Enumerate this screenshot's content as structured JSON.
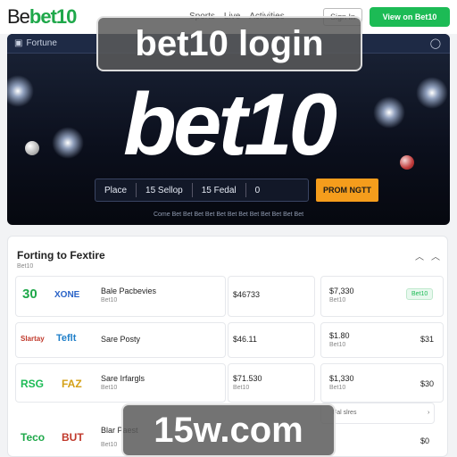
{
  "brand": {
    "prefix": "Be",
    "name": "bet10"
  },
  "topnav": {
    "items": [
      "Sports",
      "Live",
      "Activities"
    ]
  },
  "header": {
    "signin": "Sign In",
    "cta": "View on Bet10"
  },
  "hero": {
    "bar_label": "Fortune",
    "bar_right": "◯",
    "title": "bet10",
    "search": {
      "segments": [
        {
          "label": "Place"
        },
        {
          "label": "15 Sellop"
        },
        {
          "label": "15 Fedal"
        },
        {
          "label": "0"
        }
      ]
    },
    "promo_button": "PROM NGTT",
    "subtitle": "Come Bet Bet Bet Bet Bet Bet Bet Bet Bet Bet Bet Bet"
  },
  "section": {
    "title": "Forting to Fextire",
    "subtitle": "Bet10",
    "rows": [
      {
        "team_a": "30",
        "team_b": "XONE",
        "name": "Bale Pacbevies",
        "sub": "Bet10",
        "odd1": "$46733",
        "odd2": "$7,330",
        "odd2sub": "Bet10",
        "badge": "Bet10",
        "colors": {
          "a": "#1fa84a",
          "b": "#2a63c7"
        }
      },
      {
        "team_a": "Slartay",
        "team_b": "Teflt",
        "name": "Sare Posty",
        "sub": "",
        "odd1": "$46.11",
        "odd2": "$1.80",
        "odd2sub": "Bet10",
        "side": "$31",
        "colors": {
          "a": "#c0392b",
          "b": "#1f7fc9"
        }
      },
      {
        "team_a": "RSG",
        "team_b": "FAZ",
        "name": "Sare Irfargls",
        "sub": "Bet10",
        "odd1": "$71.530",
        "odd1sub": "Bet10",
        "odd2": "$1,330",
        "odd2sub": "Bet10",
        "side": "$30",
        "colors": {
          "a": "#1cbb55",
          "b": "#d4a017"
        }
      },
      {
        "team_a": "Teco",
        "team_b": "BUT",
        "name": "Blar Paest",
        "sub": "Bet10",
        "odd1": "",
        "odd2": "",
        "side": "$0",
        "colors": {
          "a": "#1fa84a",
          "b": "#c0392b"
        }
      }
    ],
    "more": "Fal slres"
  },
  "overlays": {
    "top": "bet10 login",
    "bottom": "15w.com"
  }
}
